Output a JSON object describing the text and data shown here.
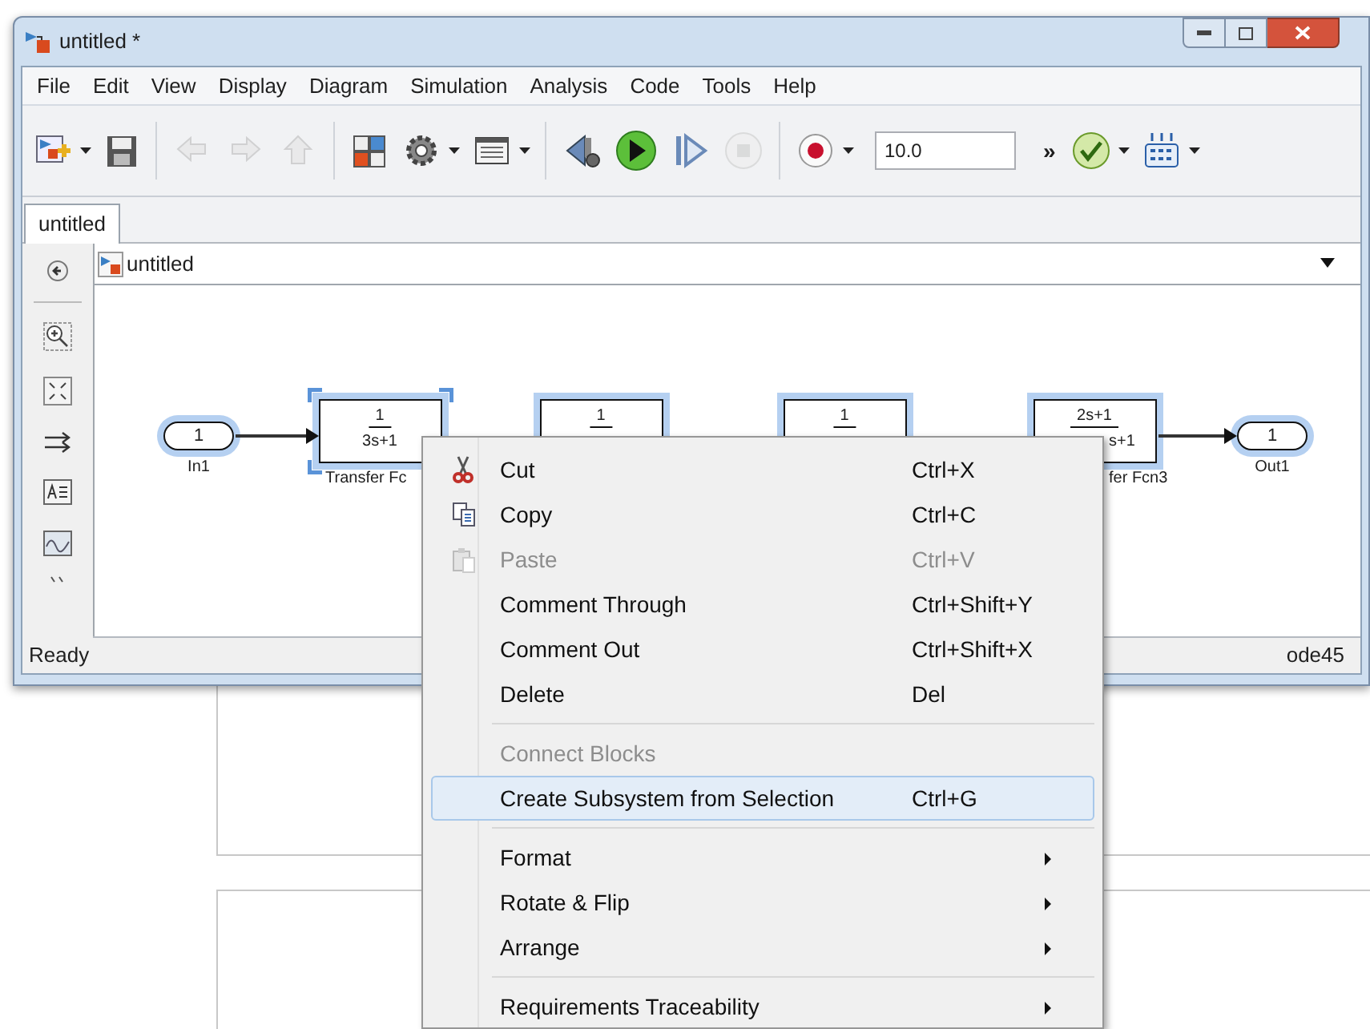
{
  "window": {
    "title": "untitled *"
  },
  "menu_bar": [
    "File",
    "Edit",
    "View",
    "Display",
    "Diagram",
    "Simulation",
    "Analysis",
    "Code",
    "Tools",
    "Help"
  ],
  "toolbar": {
    "buttons": [
      {
        "kind": "new_model",
        "dropdown": true,
        "disabled": false
      },
      {
        "kind": "save",
        "dropdown": false,
        "disabled": false
      },
      {
        "kind": "sep"
      },
      {
        "kind": "back",
        "dropdown": false,
        "disabled": true
      },
      {
        "kind": "forward",
        "dropdown": false,
        "disabled": true
      },
      {
        "kind": "up",
        "dropdown": false,
        "disabled": true
      },
      {
        "kind": "sep"
      },
      {
        "kind": "library",
        "dropdown": false,
        "disabled": false
      },
      {
        "kind": "gear",
        "dropdown": true,
        "disabled": false
      },
      {
        "kind": "config",
        "dropdown": true,
        "disabled": false
      },
      {
        "kind": "sep"
      },
      {
        "kind": "step_back",
        "dropdown": false,
        "disabled": false
      },
      {
        "kind": "run",
        "dropdown": false,
        "disabled": false
      },
      {
        "kind": "step_forward",
        "dropdown": false,
        "disabled": false
      },
      {
        "kind": "stop",
        "dropdown": false,
        "disabled": true
      },
      {
        "kind": "sep"
      },
      {
        "kind": "record",
        "dropdown": true,
        "disabled": false
      }
    ],
    "stop_time": "10.0",
    "overflow": "»",
    "trailing": [
      {
        "kind": "check",
        "dropdown": true,
        "disabled": false
      },
      {
        "kind": "grid",
        "dropdown": true,
        "disabled": false
      }
    ]
  },
  "tabs": [
    {
      "label": "untitled",
      "selected": true
    }
  ],
  "breadcrumb": "untitled",
  "diagram": {
    "blocks": [
      {
        "kind": "inport",
        "value": "1",
        "label": "In1",
        "selected": true,
        "current": false
      },
      {
        "kind": "transfer",
        "numerator": "1",
        "denominator": "3s+1",
        "label": "Transfer Fc",
        "selected": true,
        "current": true
      },
      {
        "kind": "transfer",
        "numerator": "1",
        "selected": true,
        "current": false
      },
      {
        "kind": "transfer",
        "numerator": "1",
        "selected": true,
        "current": false
      },
      {
        "kind": "transfer",
        "numerator": "2s+1",
        "denominator": "s+1",
        "label": "fer Fcn3",
        "selected": true,
        "current": false
      },
      {
        "kind": "outport",
        "value": "1",
        "label": "Out1",
        "selected": true,
        "current": false
      }
    ]
  },
  "status_bar": {
    "status": "Ready",
    "solver": "ode45"
  },
  "context_menu": [
    {
      "kind": "item",
      "label": "Cut",
      "shortcut": "Ctrl+X",
      "disabled": false,
      "selected": false
    },
    {
      "kind": "item",
      "label": "Copy",
      "shortcut": "Ctrl+C",
      "disabled": false,
      "selected": false
    },
    {
      "kind": "item",
      "label": "Paste",
      "shortcut": "Ctrl+V",
      "disabled": true,
      "selected": false
    },
    {
      "kind": "item",
      "label": "Comment Through",
      "shortcut": "Ctrl+Shift+Y",
      "disabled": false,
      "selected": false
    },
    {
      "kind": "item",
      "label": "Comment Out",
      "shortcut": "Ctrl+Shift+X",
      "disabled": false,
      "selected": false
    },
    {
      "kind": "item",
      "label": "Delete",
      "shortcut": "Del",
      "disabled": false,
      "selected": false
    },
    {
      "kind": "separator"
    },
    {
      "kind": "item",
      "label": "Connect Blocks",
      "disabled": true,
      "selected": false
    },
    {
      "kind": "item",
      "label": "Create Subsystem from Selection",
      "shortcut": "Ctrl+G",
      "disabled": false,
      "selected": true
    },
    {
      "kind": "separator"
    },
    {
      "kind": "submenu",
      "label": "Format",
      "disabled": false,
      "selected": false
    },
    {
      "kind": "submenu",
      "label": "Rotate & Flip",
      "disabled": false,
      "selected": false
    },
    {
      "kind": "submenu",
      "label": "Arrange",
      "disabled": false,
      "selected": false
    },
    {
      "kind": "separator"
    },
    {
      "kind": "submenu",
      "label": "Requirements Traceability",
      "disabled": false,
      "selected": false
    }
  ]
}
